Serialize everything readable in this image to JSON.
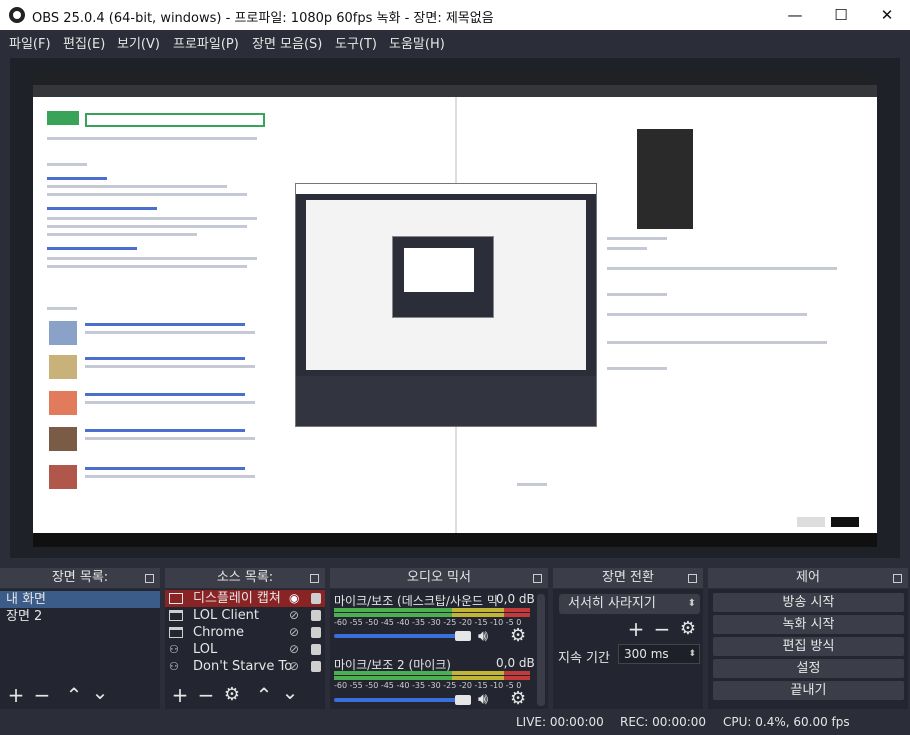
{
  "window": {
    "title": "OBS 25.0.4 (64-bit, windows) - 프로파일: 1080p 60fps 녹화 - 장면: 제목없음",
    "minimize": "—",
    "maximize": "☐",
    "close": "✕"
  },
  "menu": [
    "파일(F)",
    "편집(E)",
    "보기(V)",
    "프로파일(P)",
    "장면 모음(S)",
    "도구(T)",
    "도움말(H)"
  ],
  "docks": {
    "scenes": {
      "title": "장면 목록:",
      "items": [
        {
          "label": "내 화면",
          "selected": true
        },
        {
          "label": "장면 2",
          "selected": false
        }
      ]
    },
    "sources": {
      "title": "소스 목록:",
      "items": [
        {
          "label": "디스플레이 캡쳐",
          "icon": "monitor-icon",
          "visible": true
        },
        {
          "label": "LOL Client",
          "icon": "window-icon",
          "visible": false
        },
        {
          "label": "Chrome",
          "icon": "window-icon",
          "visible": false
        },
        {
          "label": "LOL",
          "icon": "gamepad-icon",
          "visible": false
        },
        {
          "label": "Don't Starve To",
          "icon": "gamepad-icon",
          "visible": false
        }
      ]
    },
    "mixer": {
      "title": "오디오 믹서",
      "tracks": [
        {
          "name": "마이크/보조 (데스크탑/사운드 믹",
          "db": "0,0 dB",
          "ticks": "-60 -55 -50 -45 -40 -35 -30 -25 -20 -15 -10 -5 0"
        },
        {
          "name": "마이크/보조 2 (마이크)",
          "db": "0,0 dB",
          "ticks": "-60 -55 -50 -45 -40 -35 -30 -25 -20 -15 -10 -5 0"
        }
      ]
    },
    "transitions": {
      "title": "장면 전환",
      "selected": "서서히 사라지기",
      "duration_label": "지속 기간",
      "duration_value": "300 ms"
    },
    "controls": {
      "title": "제어",
      "buttons": [
        "방송 시작",
        "녹화 시작",
        "편집 방식",
        "설정",
        "끝내기"
      ]
    }
  },
  "status": {
    "live": "LIVE: 00:00:00",
    "rec": "REC: 00:00:00",
    "cpu": "CPU: 0.4%, 60.00 fps"
  }
}
